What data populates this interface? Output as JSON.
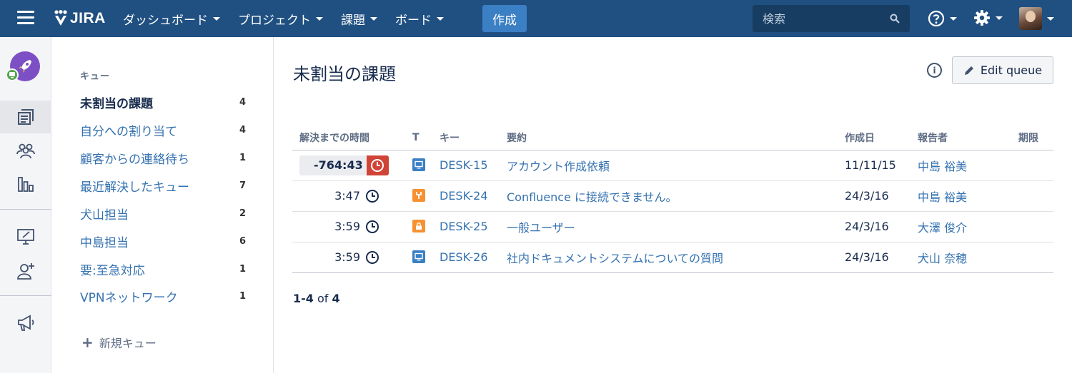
{
  "topnav": {
    "logo_text": "JIRA",
    "menu": [
      {
        "label": "ダッシュボード"
      },
      {
        "label": "プロジェクト"
      },
      {
        "label": "課題"
      },
      {
        "label": "ボード"
      }
    ],
    "create_label": "作成",
    "search_placeholder": "検索",
    "help_icon": "question-circle-icon",
    "settings_icon": "gear-icon",
    "bg_color": "#205081"
  },
  "rail": {
    "icons": [
      "project-rocket-avatar",
      "queues-icon",
      "customers-icon",
      "reports-icon",
      "raise-request-icon",
      "invite-team-icon",
      "announcement-icon"
    ]
  },
  "sidebar": {
    "heading": "キュー",
    "queues": [
      {
        "label": "未割当の課題",
        "count": "4",
        "active": true
      },
      {
        "label": "自分への割り当て",
        "count": "4"
      },
      {
        "label": "顧客からの連絡待ち",
        "count": "1"
      },
      {
        "label": "最近解決したキュー",
        "count": "7"
      },
      {
        "label": "犬山担当",
        "count": "2"
      },
      {
        "label": "中島担当",
        "count": "6"
      },
      {
        "label": "要:至急対応",
        "count": "1"
      },
      {
        "label": "VPNネットワーク",
        "count": "1"
      }
    ],
    "new_queue": "新規キュー"
  },
  "main": {
    "title": "未割当の課題",
    "edit_queue": "Edit queue",
    "columns": [
      "解決までの時間",
      "T",
      "キー",
      "要約",
      "作成日",
      "報告者",
      "期限"
    ],
    "rows": [
      {
        "time": "-764:43",
        "breached": true,
        "type_color": "#3b7fc4",
        "type": "service-request-icon",
        "key": "DESK-15",
        "summary": "アカウント作成依頼",
        "created": "11/11/15",
        "reporter": "中島 裕美",
        "due": ""
      },
      {
        "time": "3:47",
        "breached": false,
        "type_color": "#f79232",
        "type": "fault-icon",
        "key": "DESK-24",
        "summary": "Confluence に接続できません。",
        "created": "24/3/16",
        "reporter": "中島 裕美",
        "due": ""
      },
      {
        "time": "3:59",
        "breached": false,
        "type_color": "#f79232",
        "type": "access-icon",
        "key": "DESK-25",
        "summary": "一般ユーザー",
        "created": "24/3/16",
        "reporter": "大澤 俊介",
        "due": ""
      },
      {
        "time": "3:59",
        "breached": false,
        "type_color": "#3b7fc4",
        "type": "service-request-icon",
        "key": "DESK-26",
        "summary": "社内ドキュメントシステムについての質問",
        "created": "24/3/16",
        "reporter": "犬山 奈穂",
        "due": ""
      }
    ],
    "pager": {
      "range": "1-4",
      "of": "of",
      "total": "4"
    }
  }
}
